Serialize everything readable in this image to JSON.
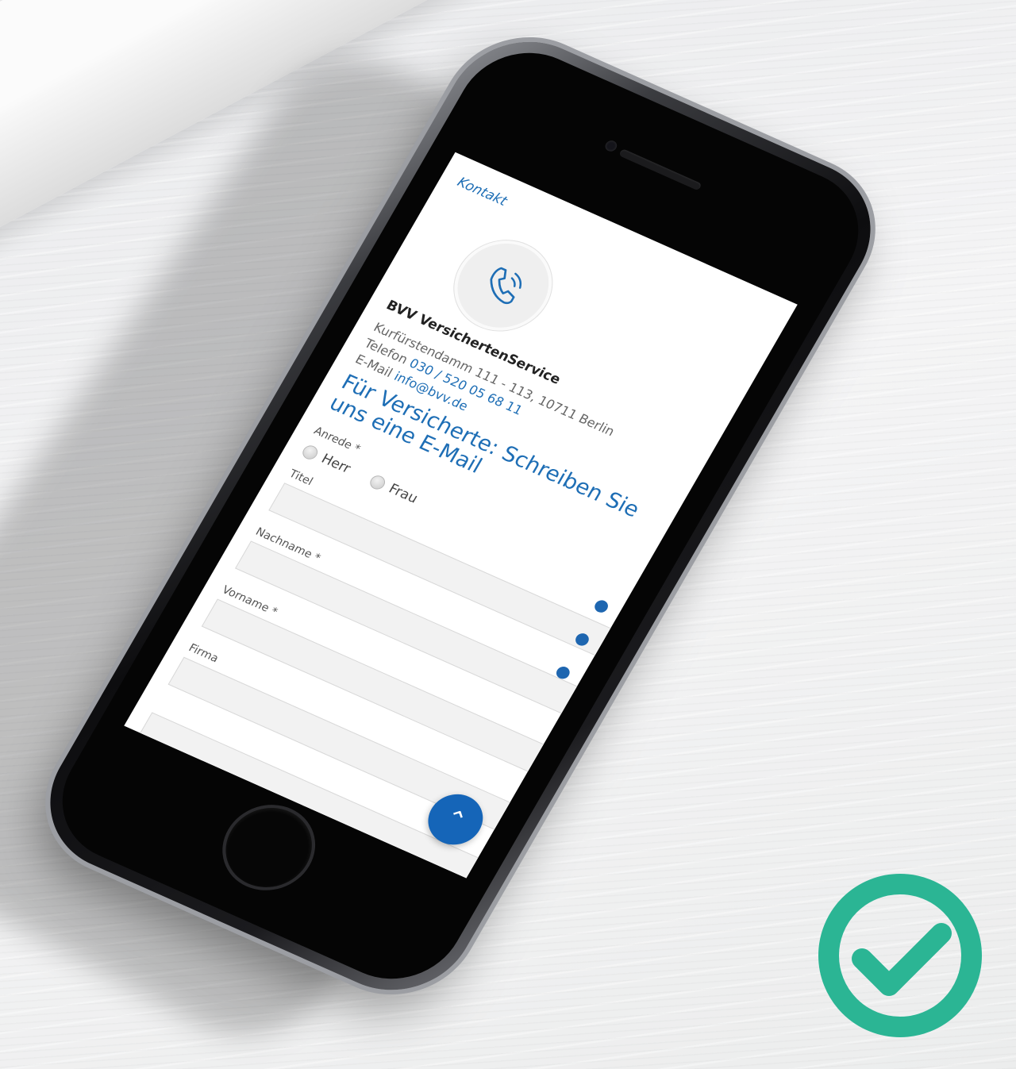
{
  "screen": {
    "breadcrumb": "Kontakt",
    "contact": {
      "icon": "phone-ringing-icon",
      "org_name": "BVV VersichertenService",
      "address": "Kurfürstendamm 111 - 113, 10711 Berlin",
      "phone_label": "Telefon",
      "phone_number": "030 / 520 05 68 11",
      "email_label": "E-Mail",
      "email": "info@bvv.de"
    },
    "form": {
      "heading": "Für Versicherte: Schreiben Sie uns eine E-Mail",
      "salutation_label": "Anrede *",
      "salutation_options": [
        "Herr",
        "Frau"
      ],
      "title_label": "Titel",
      "lastname_label": "Nachname *",
      "firstname_label": "Vorname *",
      "company_label": "Firma"
    },
    "scroll_top_icon": "chevron-up-icon"
  },
  "colors": {
    "accent": "#1e6eb5",
    "check": "#2bb594"
  },
  "badge_icon": "checkmark-circle-icon"
}
